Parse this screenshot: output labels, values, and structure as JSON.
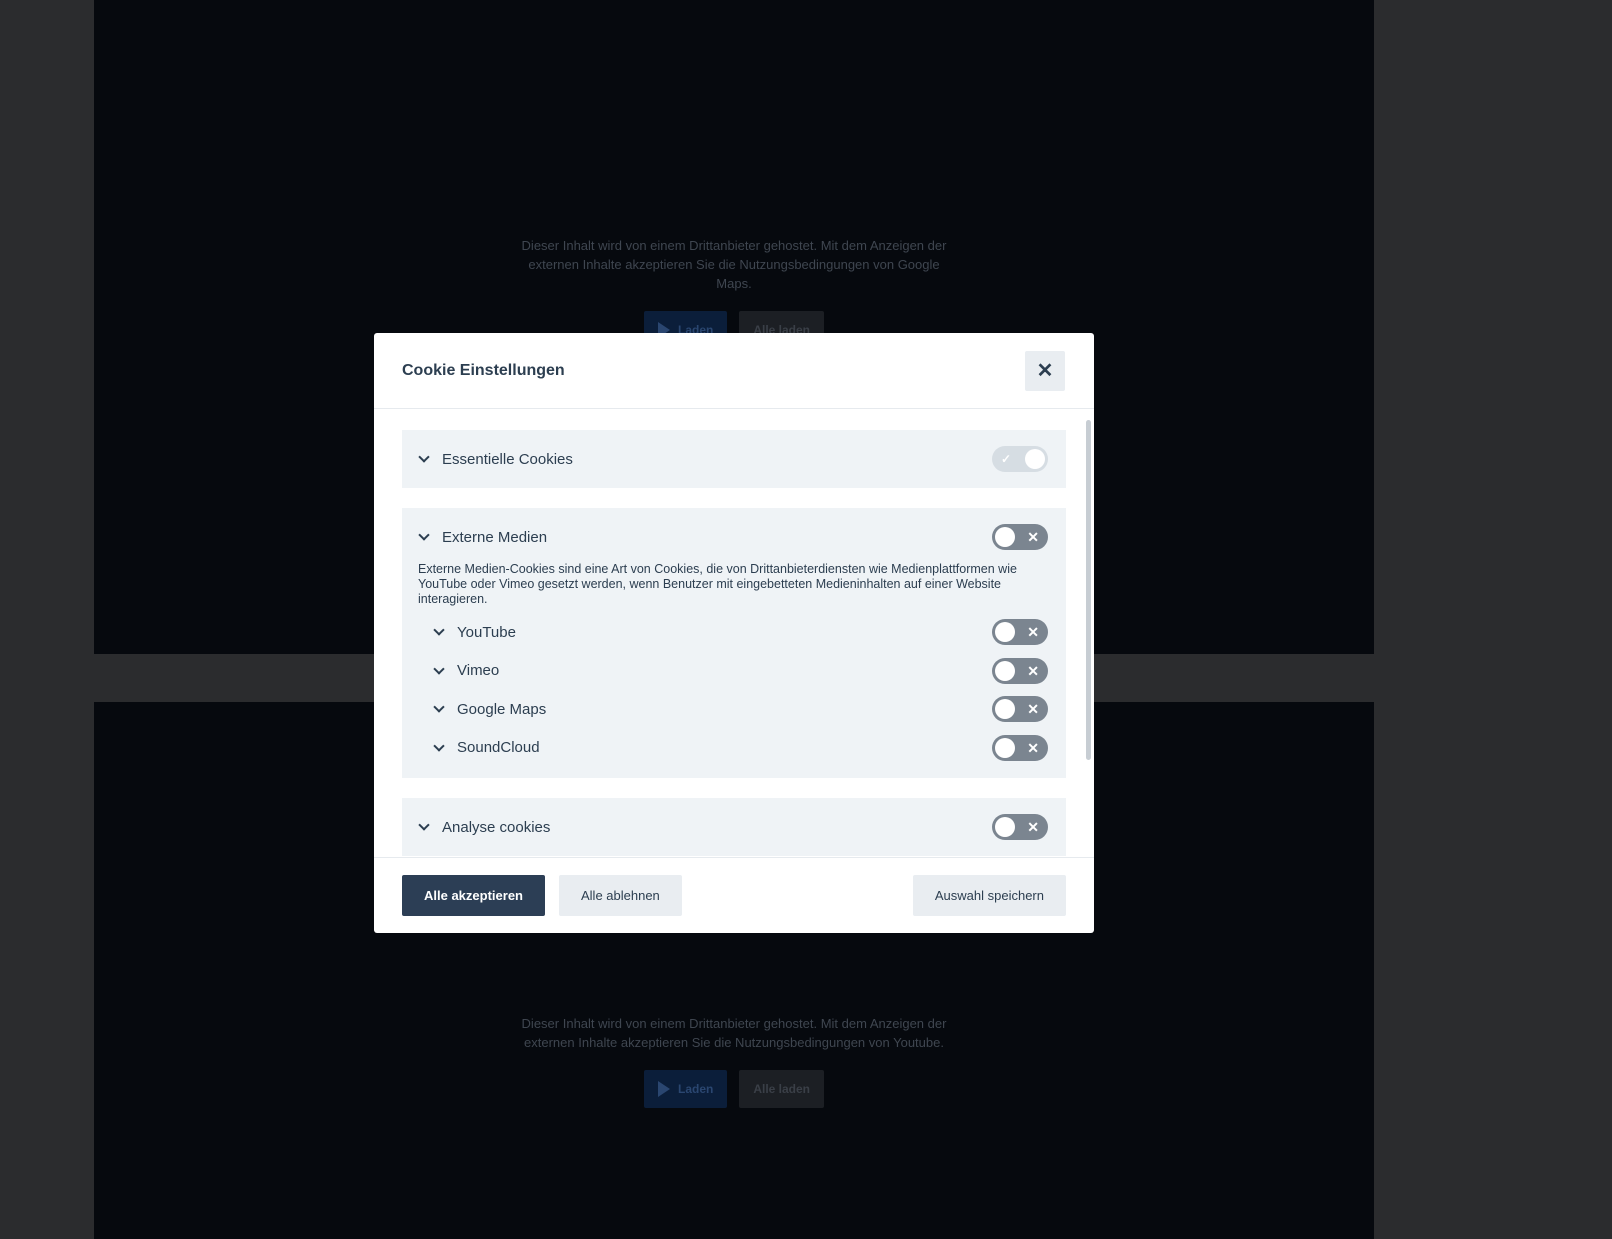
{
  "embeds": [
    {
      "notice": "Dieser Inhalt wird von einem Drittanbieter gehostet. Mit dem Anzeigen der externen Inhalte akzeptieren Sie die Nutzungsbedingungen von Google Maps.",
      "load_label": "Laden",
      "load_all_label": "Alle laden"
    },
    {
      "notice": "Dieser Inhalt wird von einem Drittanbieter gehostet. Mit dem Anzeigen der externen Inhalte akzeptieren Sie die Nutzungsbedingungen von Youtube.",
      "load_label": "Laden",
      "load_all_label": "Alle laden"
    }
  ],
  "modal": {
    "title": "Cookie Einstellungen",
    "close_icon": "close-icon",
    "sections": {
      "essential": {
        "label": "Essentielle Cookies",
        "enabled": true,
        "disabled": true
      },
      "external": {
        "label": "Externe Medien",
        "enabled": false,
        "description": "Externe Medien-Cookies sind eine Art von Cookies, die von Drittanbieterdiensten wie Medienplattformen wie YouTube oder Vimeo gesetzt werden, wenn Benutzer mit eingebetteten Medieninhalten auf einer Website interagieren.",
        "items": [
          {
            "label": "YouTube",
            "enabled": false
          },
          {
            "label": "Vimeo",
            "enabled": false
          },
          {
            "label": "Google Maps",
            "enabled": false
          },
          {
            "label": "SoundCloud",
            "enabled": false
          }
        ]
      },
      "analyse": {
        "label": "Analyse cookies",
        "enabled": false
      }
    },
    "toggle_off_mark": "✕",
    "toggle_on_mark": "✓",
    "footer": {
      "accept_all": "Alle akzeptieren",
      "reject_all": "Alle ablehnen",
      "save": "Auswahl speichern"
    }
  },
  "colors": {
    "primary": "#2c3e55",
    "section_bg": "#eff3f6",
    "toggle_off": "#7b8590"
  }
}
